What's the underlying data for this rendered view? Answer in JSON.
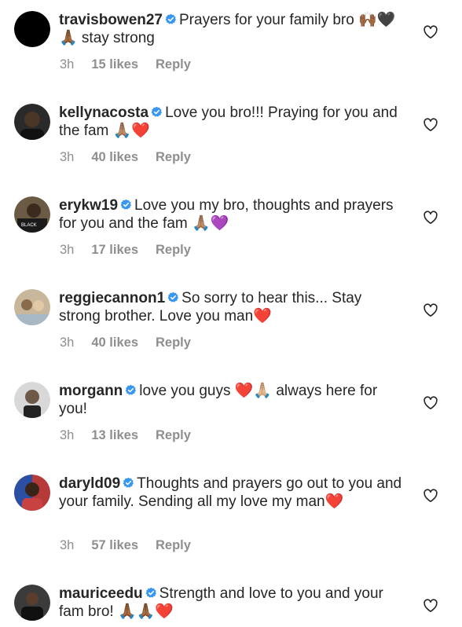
{
  "comments": [
    {
      "username": "travisbowen27",
      "text": "Prayers for your family bro 🙌🏾🖤🙏🏾 stay strong",
      "time": "3h",
      "likes": "15 likes",
      "reply": "Reply",
      "avatar_color": "#000000"
    },
    {
      "username": "kellynacosta",
      "text": "Love you bro!!! Praying for you and the fam 🙏🏽❤️",
      "time": "3h",
      "likes": "40 likes",
      "reply": "Reply",
      "avatar_color": "#2a2a2a"
    },
    {
      "username": "erykw19",
      "text": "Love you my bro, thoughts and prayers for you and the fam 🙏🏽💜",
      "time": "3h",
      "likes": "17 likes",
      "reply": "Reply",
      "avatar_color": "#6b5a44"
    },
    {
      "username": "reggiecannon1",
      "text": "So sorry to hear this... Stay strong brother. Love you man❤️",
      "time": "3h",
      "likes": "40 likes",
      "reply": "Reply",
      "avatar_color": "#c9b79c"
    },
    {
      "username": "morgann",
      "text": "love you guys ❤️🙏🏼 always here for you!",
      "time": "3h",
      "likes": "13 likes",
      "reply": "Reply",
      "avatar_color": "#d8d8d8"
    },
    {
      "username": "daryld09",
      "text": "Thoughts and prayers go out to you and your family. Sending all my love my man❤️",
      "time": "3h",
      "likes": "57 likes",
      "reply": "Reply",
      "avatar_color": "#b73a3a"
    },
    {
      "username": "mauriceedu",
      "text": "Strength and love to you and your fam bro! 🙏🏾🙏🏾❤️",
      "time": "",
      "likes": "",
      "reply": "",
      "avatar_color": "#3b3b3b"
    }
  ],
  "colors": {
    "text": "#262626",
    "meta": "#8e8e8e",
    "verified": "#3897f0"
  },
  "icons": {
    "verified": "verified-badge-icon",
    "like": "heart-outline-icon"
  }
}
